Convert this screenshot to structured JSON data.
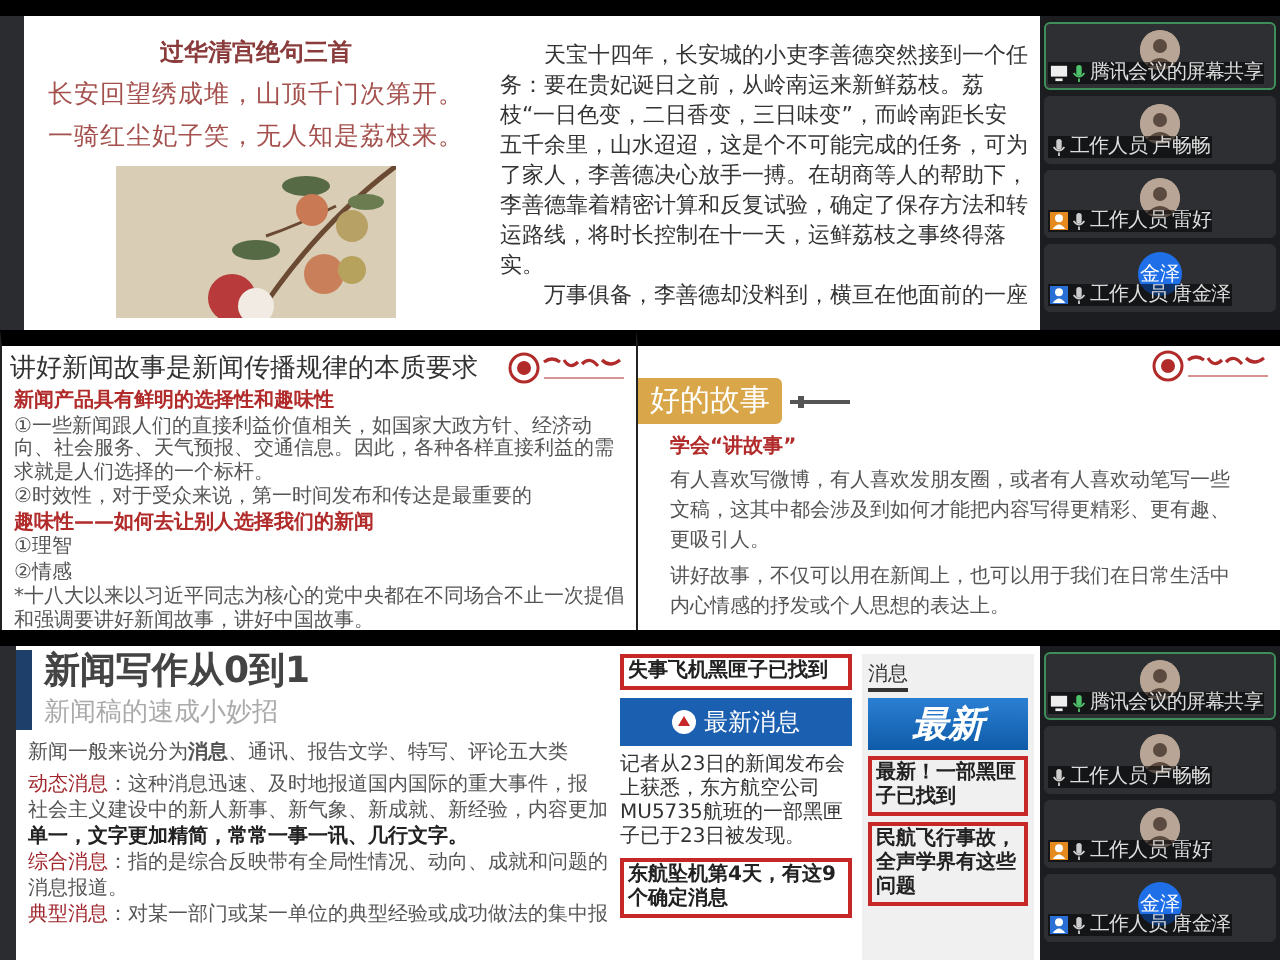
{
  "top_share": {
    "slide": {
      "poem_title": "过华清宫绝句三首",
      "poem_lines": [
        "长安回望绣成堆，山顶千门次第开。",
        "一骑红尘妃子笑，无人知是荔枝来。"
      ],
      "paragraphs": [
        "天宝十四年，长安城的小吏李善德突然接到一个任务：要在贵妃诞日之前，从岭南运来新鲜荔枝。荔枝“一日色变，二日香变，三日味变”，而岭南距长安五千余里，山水迢迢，这是个不可能完成的任务，可为了家人，李善德决心放手一搏。在胡商等人的帮助下，李善德靠着精密计算和反复试验，确定了保存方法和转运路线，将时长控制在十一天，运鲜荔枝之事终得落实。",
        "万事俱备，李善德却没料到，横亘在他面前的一座"
      ]
    },
    "participants": [
      {
        "name": "腾讯会议的屏幕共享",
        "highlighted": true,
        "sharing": true
      },
      {
        "name": "工作人员 卢畅畅",
        "highlighted": false,
        "sharing": false
      },
      {
        "name": "工作人员 雷好",
        "highlighted": false,
        "sharing": false,
        "color": "#e58a1f"
      },
      {
        "name": "工作人员 唐金泽",
        "highlighted": false,
        "initials": "金泽",
        "sharing": false,
        "color": "#2a6fd6"
      }
    ]
  },
  "middle_left": {
    "title": "讲好新闻故事是新闻传播规律的本质要求",
    "items": [
      {
        "kind": "heading",
        "text": "新闻产品具有鲜明的选择性和趣味性"
      },
      {
        "kind": "text",
        "text": "①一些新闻跟人们的直接利益价值相关，如国家大政方针、经济动向、社会服务、天气预报、交通信息。因此，各种各样直接利益的需求就是人们选择的一个标杆。"
      },
      {
        "kind": "text",
        "text": "②时效性，对于受众来说，第一时间发布和传达是最重要的"
      },
      {
        "kind": "heading",
        "text": "趣味性——如何去让别人选择我们的新闻"
      },
      {
        "kind": "text",
        "text": "①理智"
      },
      {
        "kind": "text",
        "text": "②情感"
      },
      {
        "kind": "text",
        "text": "*十八大以来以习近平同志为核心的党中央都在不同场合不止一次提倡和强调要讲好新闻故事，讲好中国故事。"
      }
    ]
  },
  "middle_right": {
    "tag": "好的故事",
    "subtitle": "学会“讲故事”",
    "paragraphs": [
      "有人喜欢写微博，有人喜欢发朋友圈，或者有人喜欢动笔写一些文稿，这其中都会涉及到如何才能把内容写得更精彩、更有趣、更吸引人。",
      "讲好故事，不仅可以用在新闻上，也可以用于我们在日常生活中内心情感的抒发或个人思想的表达上。"
    ]
  },
  "bottom_share": {
    "slide": {
      "title": "新闻写作从0到1",
      "subtitle": "新闻稿的速成小妙招",
      "intro": "新闻一般来说分为**消息**、通讯、报告文学、特写、评论五大类",
      "lines": [
        {
          "kind": "lead",
          "label": "动态消息",
          "text": "：这种消息迅速、及时地报道国内国际的重大事件，报"
        },
        {
          "kind": "plain",
          "text": "社会主义建设中的新人新事、新气象、新成就、新经验，内容更加"
        },
        {
          "kind": "bold",
          "text": "单一，文字更加精简，常常一事一讯、几行文字。"
        },
        {
          "kind": "lead",
          "label": "综合消息",
          "text": "：指的是综合反映带有全局性情况、动向、成就和问题的"
        },
        {
          "kind": "plain",
          "text": "消息报道。"
        },
        {
          "kind": "lead",
          "label": "典型消息",
          "text": "：对某一部门或某一单位的典型经验或成功做法的集中报"
        }
      ],
      "article": {
        "headline": "失事飞机黑匣子已找到",
        "banner": "最新消息",
        "body": "记者从23日的新闻发布会上获悉，东方航空公司MU5735航班的一部黑匣子已于23日被发现。",
        "callout": "东航坠机第4天，有这9个确定消息"
      },
      "phone": {
        "tab": "消息",
        "banner": "最新",
        "caption": "最新！一部黑匣子已找到",
        "callout": "民航飞行事故，全声学界有这些问题"
      }
    },
    "participants": [
      {
        "name": "腾讯会议的屏幕共享",
        "highlighted": true,
        "sharing": true
      },
      {
        "name": "工作人员 卢畅畅",
        "highlighted": false,
        "sharing": false
      },
      {
        "name": "工作人员 雷好",
        "highlighted": false,
        "sharing": false,
        "color": "#e58a1f"
      },
      {
        "name": "工作人员 唐金泽",
        "highlighted": false,
        "initials": "金泽",
        "sharing": false,
        "color": "#2a6fd6"
      }
    ]
  }
}
